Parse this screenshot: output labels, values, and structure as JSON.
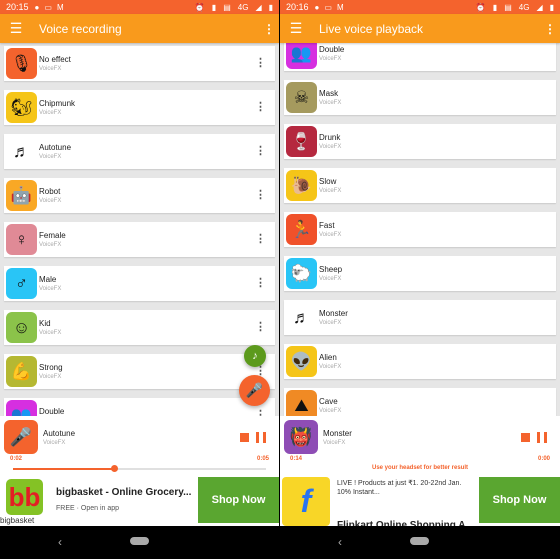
{
  "left": {
    "status": {
      "time": "20:15",
      "left_icons": [
        "whatsapp-icon",
        "cast-icon",
        "gmail-icon"
      ],
      "right_icons": [
        "alarm-icon",
        "vibrate-icon",
        "volte-icon",
        "4g-icon",
        "signal-icon",
        "battery-icon"
      ]
    },
    "appbar": {
      "title": "Voice recording"
    },
    "items": [
      {
        "name": "No effect",
        "sub": "VoiceFX",
        "icon": "waveform-mic-icon",
        "glyph": "🎙",
        "color": "#f4632d"
      },
      {
        "name": "Chipmunk",
        "sub": "VoiceFX",
        "icon": "chipmunk-icon",
        "glyph": "🐿",
        "color": "#f5c518"
      },
      {
        "name": "Autotune",
        "sub": "VoiceFX",
        "icon": "autotune-icon",
        "glyph": "♬",
        "color": "#ffffff"
      },
      {
        "name": "Robot",
        "sub": "VoiceFX",
        "icon": "robot-icon",
        "glyph": "🤖",
        "color": "#f9a825"
      },
      {
        "name": "Female",
        "sub": "VoiceFX",
        "icon": "female-icon",
        "glyph": "♀",
        "color": "#e08a96"
      },
      {
        "name": "Male",
        "sub": "VoiceFX",
        "icon": "male-icon",
        "glyph": "♂",
        "color": "#29c5f6"
      },
      {
        "name": "Kid",
        "sub": "VoiceFX",
        "icon": "kid-icon",
        "glyph": "☺",
        "color": "#8bc34a"
      },
      {
        "name": "Strong",
        "sub": "VoiceFX",
        "icon": "strong-arm-icon",
        "glyph": "💪",
        "color": "#b5b832"
      },
      {
        "name": "Double",
        "sub": "VoiceFX",
        "icon": "double-people-icon",
        "glyph": "👥",
        "color": "#d62fe0"
      }
    ],
    "player": {
      "name": "Autotune",
      "sub": "VoiceFX",
      "elapsed": "0:02",
      "total": "0:05",
      "progress": 0.4,
      "icon_color": "#f4632d"
    },
    "ad": {
      "title": "bigbasket - Online Grocery...",
      "subtitle": "FREE · Open in app",
      "brand": "bigbasket",
      "button": "Shop Now",
      "logo_glyph": "bb"
    }
  },
  "right": {
    "status": {
      "time": "20:16"
    },
    "appbar": {
      "title": "Live voice playback"
    },
    "items": [
      {
        "name": "Double",
        "sub": "VoiceFX",
        "icon": "double-people-icon",
        "glyph": "👥",
        "color": "#d62fe0"
      },
      {
        "name": "Mask",
        "sub": "VoiceFX",
        "icon": "gas-mask-icon",
        "glyph": "☠",
        "color": "#a59a5e"
      },
      {
        "name": "Drunk",
        "sub": "VoiceFX",
        "icon": "wine-glasses-icon",
        "glyph": "🍷",
        "color": "#b5283f"
      },
      {
        "name": "Slow",
        "sub": "VoiceFX",
        "icon": "snail-icon",
        "glyph": "🐌",
        "color": "#f5c518"
      },
      {
        "name": "Fast",
        "sub": "VoiceFX",
        "icon": "running-man-icon",
        "glyph": "🏃",
        "color": "#f0512a"
      },
      {
        "name": "Sheep",
        "sub": "VoiceFX",
        "icon": "sheep-icon",
        "glyph": "🐑",
        "color": "#29c5f6"
      },
      {
        "name": "Monster",
        "sub": "VoiceFX",
        "icon": "autotune-icon",
        "glyph": "♬",
        "color": "#ffffff"
      },
      {
        "name": "Alien",
        "sub": "VoiceFX",
        "icon": "alien-icon",
        "glyph": "👽",
        "color": "#f5c518"
      },
      {
        "name": "Cave",
        "sub": "VoiceFX",
        "icon": "cave-icon",
        "glyph": "⛰",
        "color": "#f08a24"
      }
    ],
    "player": {
      "name": "Monster",
      "sub": "VoiceFX",
      "elapsed": "0:14",
      "total": "0:00",
      "icon_color": "#8e4db5",
      "hint": "Use your headset for better result"
    },
    "ad": {
      "text": "LIVE ! Products at just ₹1. 20-22nd Jan. 10% Instant...",
      "title": "Flipkart Online Shopping A...",
      "button": "Shop Now",
      "logo_glyph": "f"
    }
  },
  "colors": {
    "accent": "#f4632d",
    "appbar": "#f99a1c",
    "ad_button": "#5aa630"
  }
}
